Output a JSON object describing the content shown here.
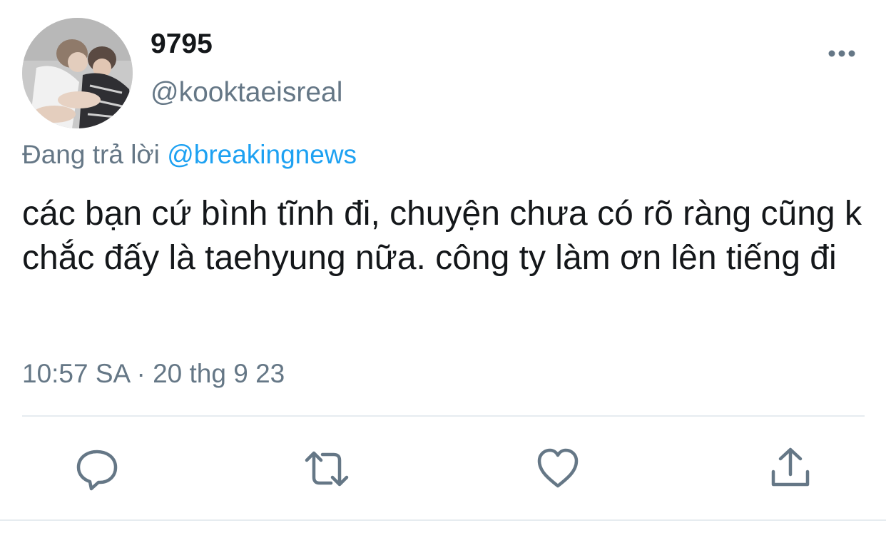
{
  "author": {
    "display_name": "9795",
    "handle": "@kooktaeisreal",
    "avatar_icon": "profile-photo"
  },
  "reply": {
    "prefix": "Đang trả lời",
    "mention": "@breakingnews"
  },
  "tweet": {
    "text": "các bạn cứ bình tĩnh đi, chuyện chưa có rõ ràng cũng k chắc đấy là taehyung nữa. công ty làm ơn lên tiếng đi"
  },
  "meta": {
    "timestamp": "10:57 SA · 20 thg 9 23"
  },
  "actions": {
    "reply_icon": "comment-icon",
    "retweet_icon": "retweet-icon",
    "like_icon": "heart-icon",
    "share_icon": "share-icon",
    "more_icon": "more-icon"
  },
  "colors": {
    "text_primary": "#14171a",
    "text_secondary": "#657786",
    "accent": "#1da1f2",
    "divider": "#e6ecf0"
  }
}
